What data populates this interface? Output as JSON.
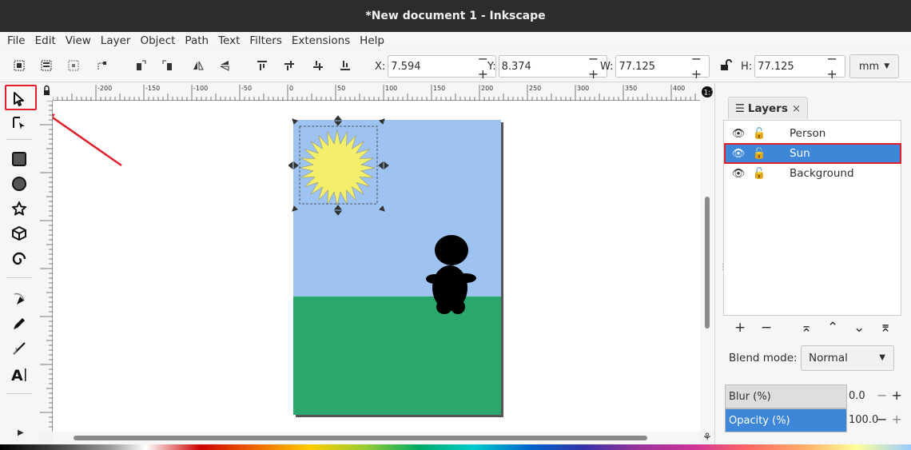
{
  "window": {
    "title": "*New document 1 - Inkscape"
  },
  "menu": [
    "File",
    "Edit",
    "View",
    "Layer",
    "Object",
    "Path",
    "Text",
    "Filters",
    "Extensions",
    "Help"
  ],
  "toolbar": {
    "x_label": "X:",
    "x_value": "7.594",
    "y_label": "Y:",
    "y_value": "8.374",
    "w_label": "W:",
    "w_value": "77.125",
    "h_label": "H:",
    "h_value": "77.125",
    "unit": "mm",
    "pm": "− +"
  },
  "ruler": {
    "labels": [
      "-200",
      "-150",
      "-100",
      "-50",
      "0",
      "50",
      "100",
      "150",
      "200",
      "250",
      "300",
      "350",
      "400"
    ]
  },
  "tools": [
    "selector-tool",
    "node-tool",
    "rectangle-tool",
    "ellipse-tool",
    "star-tool",
    "3d-box-tool",
    "spiral-tool",
    "pen-tool",
    "pencil-tool",
    "calligraphy-tool",
    "text-tool"
  ],
  "layers_panel": {
    "tab_label": "Layers",
    "tab_close": "×",
    "layers": [
      {
        "name": "Person",
        "selected": false
      },
      {
        "name": "Sun",
        "selected": true
      },
      {
        "name": "Background",
        "selected": false
      }
    ],
    "buttons": {
      "add": "+",
      "remove": "−",
      "top": "⌅",
      "up": "⌃",
      "down": "⌄",
      "bottom": "⌆"
    },
    "blend_label": "Blend mode:",
    "blend_value": "Normal",
    "blur_label": "Blur (%)",
    "blur_value": "0.0",
    "opacity_label": "Opacity (%)",
    "opacity_value": "100.0"
  },
  "colors": {
    "sky": "#9ec3f0",
    "grass": "#2aa76b",
    "sun": "#f5ee6a",
    "highlight": "#e0202a",
    "selected_row": "#3d86d8"
  }
}
